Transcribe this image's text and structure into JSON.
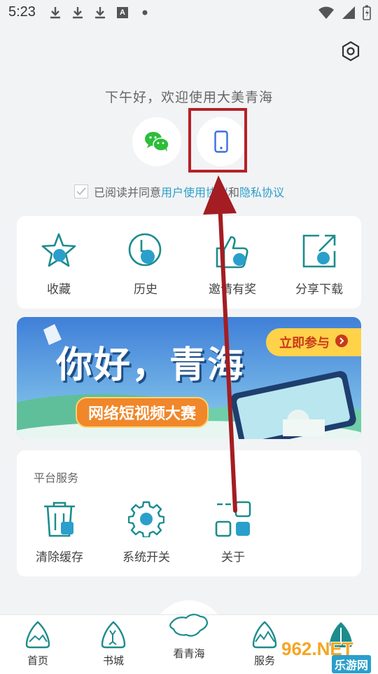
{
  "status_bar": {
    "time": "5:23",
    "download_icons": [
      "download-icon",
      "download-icon",
      "download-icon"
    ],
    "notification_badge": "A"
  },
  "greeting": "下午好，欢迎使用大美青海",
  "agreement": {
    "prefix": "已阅读并同意",
    "user_agreement": "用户使用协议",
    "conjunction": "和",
    "privacy_policy": "隐私协议"
  },
  "quick_actions": [
    {
      "label": "收藏",
      "icon": "star-icon"
    },
    {
      "label": "历史",
      "icon": "clock-icon"
    },
    {
      "label": "邀请有奖",
      "icon": "thumbs-up-icon"
    },
    {
      "label": "分享下载",
      "icon": "share-icon"
    }
  ],
  "banner": {
    "title": "你好，青海",
    "subtitle": "网络短视频大赛",
    "cta": "立即参与"
  },
  "services": {
    "title": "平台服务",
    "items": [
      {
        "label": "清除缓存",
        "icon": "trash-icon"
      },
      {
        "label": "系统开关",
        "icon": "gear-icon"
      },
      {
        "label": "关于",
        "icon": "grid-icon"
      }
    ]
  },
  "tabs": [
    {
      "label": "首页",
      "icon": "home-mountain-icon"
    },
    {
      "label": "书城",
      "icon": "book-deer-icon"
    },
    {
      "label": "看青海",
      "icon": "qinghai-map-icon"
    },
    {
      "label": "服务",
      "icon": "service-mountain-icon"
    }
  ],
  "watermark": {
    "site": "962.NET",
    "name": "乐游网"
  },
  "colors": {
    "accent": "#2a9fcb",
    "teal": "#1c8c8c",
    "highlight_box": "#b52127",
    "arrow": "#a31d22",
    "wechat": "#2dbd3a",
    "phone": "#3d6fe0"
  }
}
